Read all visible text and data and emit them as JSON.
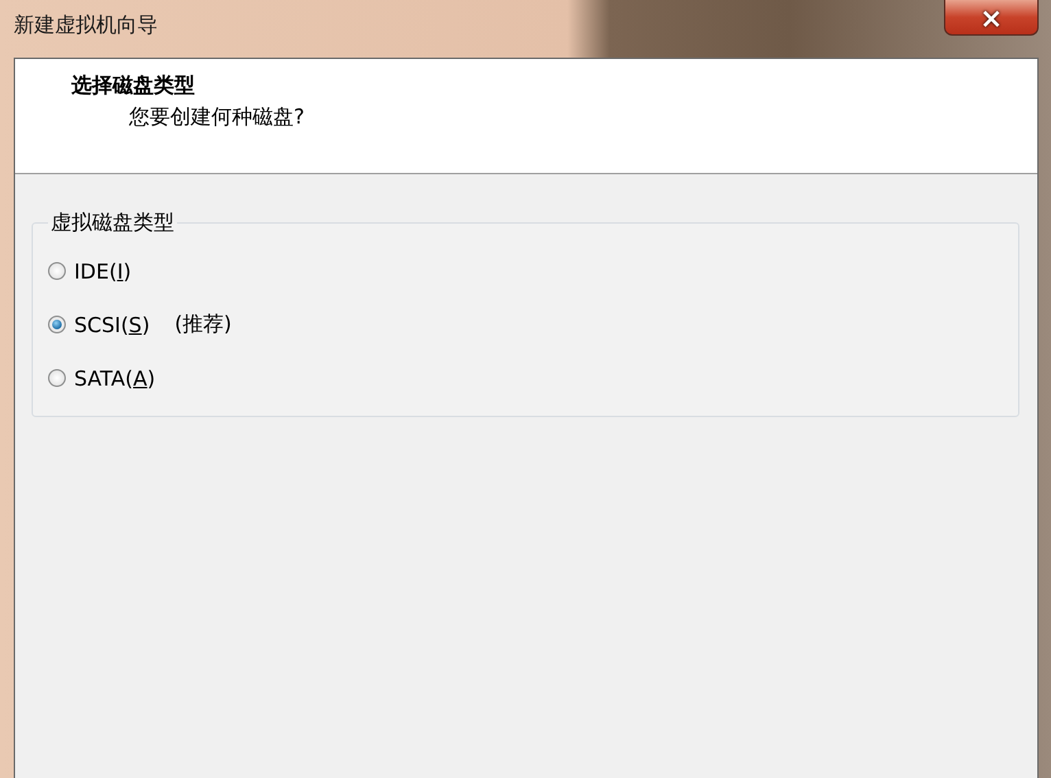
{
  "window": {
    "title": "新建虚拟机向导",
    "close": "×"
  },
  "header": {
    "title": "选择磁盘类型",
    "subtitle": "您要创建何种磁盘?"
  },
  "group": {
    "label": "虚拟磁盘类型",
    "options": [
      {
        "label": "IDE(I)",
        "selected": false
      },
      {
        "label": "SCSI(S)",
        "note": "(推荐)",
        "selected": true
      },
      {
        "label": "SATA(A)",
        "selected": false
      }
    ]
  }
}
